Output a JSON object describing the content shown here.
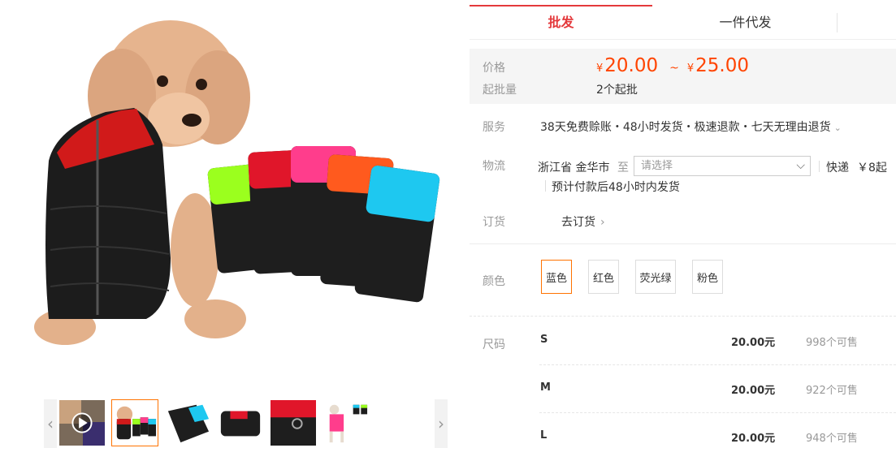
{
  "tabs": [
    {
      "label": "批发",
      "active": true
    },
    {
      "label": "一件代发",
      "active": false
    }
  ],
  "price_block": {
    "price_label": "价格",
    "currency": "¥",
    "price_min": "20.00",
    "separator": "~",
    "price_max": "25.00",
    "moq_label": "起批量",
    "moq_value": "2个起批"
  },
  "service": {
    "label": "服务",
    "text": "38天免费赊账・48小时发货・极速退款・七天无理由退货",
    "expand_icon": "chevron-down-icon"
  },
  "logistics": {
    "label": "物流",
    "origin": "浙江省 金华市",
    "to_label": "至",
    "destination_placeholder": "请选择",
    "express_label": "快递",
    "fee": "￥8起",
    "dispatch_note": "预计付款后48小时内发货"
  },
  "order": {
    "label": "订货",
    "link_text": "去订货"
  },
  "colors": {
    "label": "颜色",
    "options": [
      {
        "name": "蓝色",
        "selected": true
      },
      {
        "name": "红色",
        "selected": false
      },
      {
        "name": "荧光绿",
        "selected": false
      },
      {
        "name": "粉色",
        "selected": false
      }
    ],
    "accent": "#ff7300"
  },
  "sizes": {
    "label": "尺码",
    "rows": [
      {
        "size": "S",
        "price": "20.00元",
        "stock": "998个可售"
      },
      {
        "size": "M",
        "price": "20.00元",
        "stock": "922个可售"
      },
      {
        "size": "L",
        "price": "20.00元",
        "stock": "948个可售"
      }
    ]
  },
  "gallery": {
    "thumbnails": [
      {
        "name": "video-thumbnail",
        "active": false
      },
      {
        "name": "poodle-red-vest",
        "active": true
      },
      {
        "name": "blue-vest-flat",
        "active": false
      },
      {
        "name": "black-vest-back",
        "active": false
      },
      {
        "name": "red-vest-closeup",
        "active": false
      },
      {
        "name": "dog-pink-vest",
        "active": false
      }
    ]
  },
  "theme": {
    "price_color": "#ff4400",
    "tab_active_color": "#e4393c"
  }
}
